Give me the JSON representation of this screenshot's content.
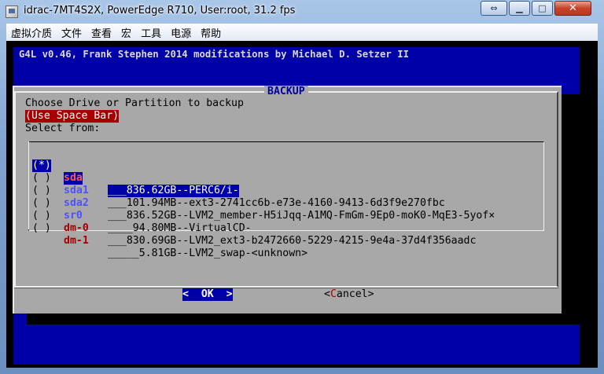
{
  "window": {
    "title": "idrac-7MT4S2X, PowerEdge R710, User:root, 31.2 fps",
    "restore_glyph": "⇔",
    "minimize_glyph": "▁",
    "maximize_glyph": "□",
    "close_glyph": "✕"
  },
  "menu": [
    "虚拟介质",
    "文件",
    "查看",
    "宏",
    "工具",
    "电源",
    "帮助"
  ],
  "console": {
    "header": "G4L v0.46, Frank Stephen 2014 modifications by Michael D. Setzer II",
    "dialog": {
      "title": "BACKUP",
      "prompt": "Choose Drive or Partition to backup",
      "hint": "(Use Space Bar)",
      "select_label": "Select from:",
      "items": [
        {
          "radio": "(*)",
          "device": "sda",
          "info": "___836.62GB--PERC6/i-"
        },
        {
          "radio": "( )",
          "device": "sda1",
          "info": "___101.94MB--ext3-2741cc6b-e73e-4160-9413-6d3f9e270fbc"
        },
        {
          "radio": "( )",
          "device": "sda2",
          "info": "___836.52GB--LVM2_member-H5iJqq-A1MQ-FmGm-9Ep0-moK0-MqE3-5yof×"
        },
        {
          "radio": "( )",
          "device": "sr0",
          "info": "____94.80MB--VirtualCD-"
        },
        {
          "radio": "( )",
          "device": "dm-0",
          "info": "___830.69GB--LVM2_ext3-b2472660-5229-4215-9e4a-37d4f356aadc"
        },
        {
          "radio": "( )",
          "device": "dm-1",
          "info": "_____5.81GB--LVM2_swap-<unknown>"
        }
      ],
      "ok_label": "<  OK  >",
      "cancel_left": "<",
      "cancel_hot": "C",
      "cancel_rest": "ancel>"
    }
  },
  "colors": {
    "console_blue": "#0000a8",
    "dialog_gray": "#a8a8a8",
    "hint_red": "#a80000",
    "device_red": "#a80000",
    "device_blue": "#5050f8"
  }
}
